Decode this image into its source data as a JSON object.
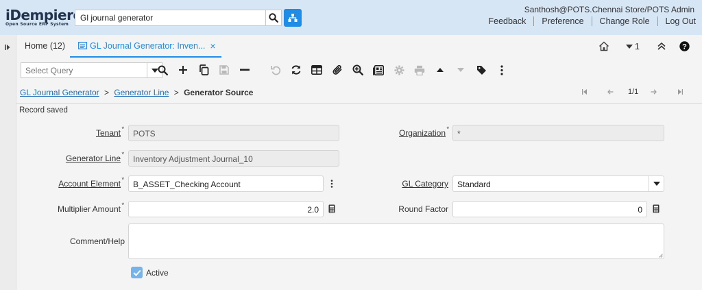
{
  "header": {
    "logo_main": "iDempiere",
    "logo_sub": "Open Source ERP System",
    "search_value": "Gl journal generator",
    "user": "Santhosh@POTS.Chennai Store/POTS Admin",
    "links": [
      "Feedback",
      "Preference",
      "Change Role",
      "Log Out"
    ]
  },
  "tabs": {
    "home": "Home (12)",
    "active": "GL Journal Generator: Inven...",
    "close": "×",
    "window_count": "1"
  },
  "toolbar": {
    "query_placeholder": "Select Query"
  },
  "breadcrumb": {
    "items": [
      "GL Journal Generator",
      "Generator Line"
    ],
    "separator": ">",
    "current": "Generator Source",
    "record_nav": "1/1"
  },
  "status_message": "Record saved",
  "form": {
    "tenant_label": "Tenant",
    "tenant_value": "POTS",
    "org_label": "Organization",
    "org_value": "*",
    "gen_line_label": "Generator Line",
    "gen_line_value": "Inventory Adjustment Journal_10",
    "account_label": "Account Element",
    "account_value": "B_ASSET_Checking Account",
    "gl_cat_label": "GL Category",
    "gl_cat_value": "Standard",
    "multiplier_label": "Multiplier Amount",
    "multiplier_value": "2.0",
    "round_label": "Round Factor",
    "round_value": "0",
    "comment_label": "Comment/Help",
    "comment_value": "",
    "active_label": "Active",
    "required_mark": "*"
  },
  "colors": {
    "accent": "#1f8de6",
    "header_bg": "#d7e6f5",
    "link": "#1f6fb8"
  }
}
